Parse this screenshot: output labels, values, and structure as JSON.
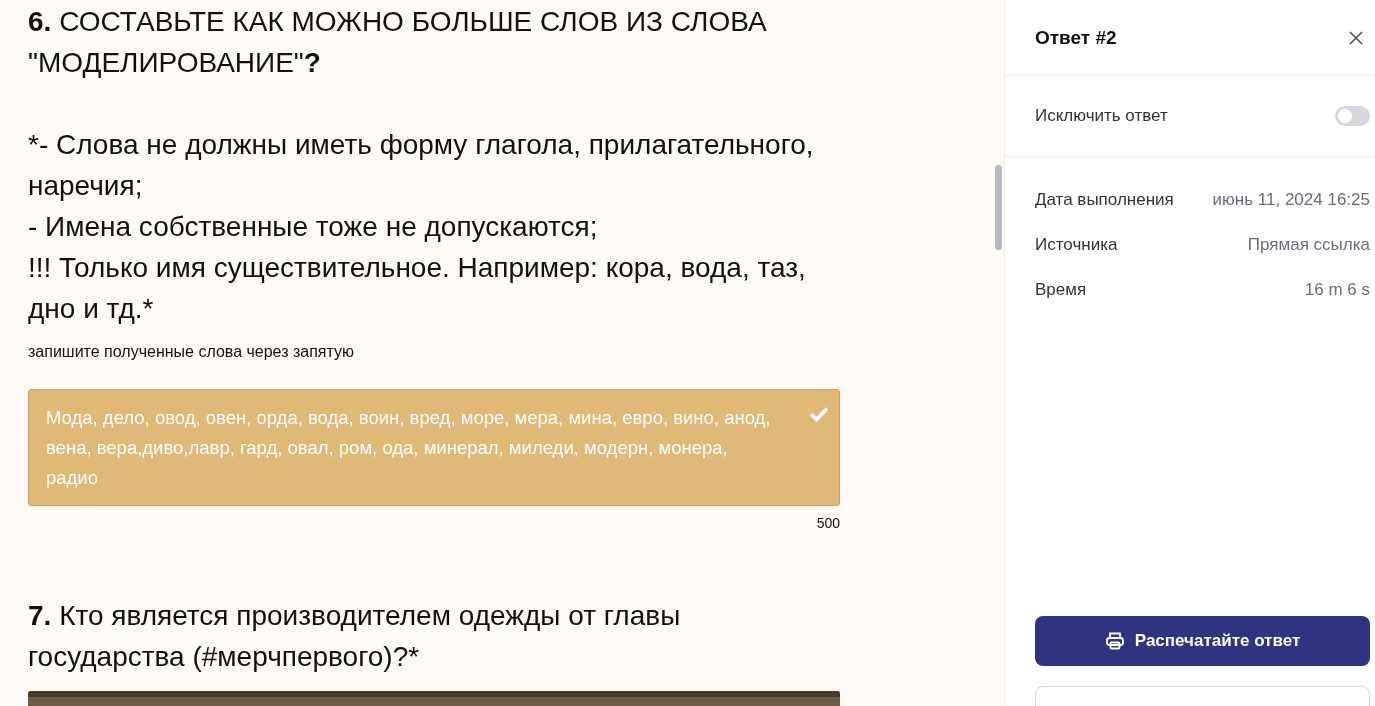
{
  "questions": [
    {
      "title": "**6.** СОСТАВЬТЕ КАК МОЖНО БОЛЬШЕ СЛОВ ИЗ СЛОВА \"МОДЕЛИРОВАНИЕ\"**?**",
      "body": "*- Слова не должны иметь форму глагола, прилагательного, наречия;\n- Имена собственные тоже не допускаются;\n!!! Только имя существительное. Например: кора, вода, таз, дно и тд.*",
      "hint": "запишите полученные слова через запятую",
      "answer": {
        "text": "Мода, дело, овод, овен, орда, вода, воин, вред, море, мера, мина, евро, вино, анод, вена, вера,диво,лавр, гард, овал, ром, ода, минерал, миледи, модерн, монера, радио",
        "correct": true,
        "counter": "500"
      }
    },
    {
      "number": "7.",
      "text": "Кто является производителем одежды от главы государства (#мерчпервого)?*"
    }
  ],
  "panel": {
    "title": "Ответ #2",
    "exclude": {
      "label": "Исключить ответ",
      "on": false
    },
    "details": [
      {
        "label": "Дата выполнения",
        "value": "июнь 11, 2024 16:25"
      },
      {
        "label": "Источника",
        "value": "Прямая ссылка"
      },
      {
        "label": "Время",
        "value": "16 m 6 s"
      }
    ],
    "buttons": [
      {
        "kind": "print",
        "label": "Распечатайте ответ"
      },
      {
        "kind": "outline"
      }
    ]
  }
}
